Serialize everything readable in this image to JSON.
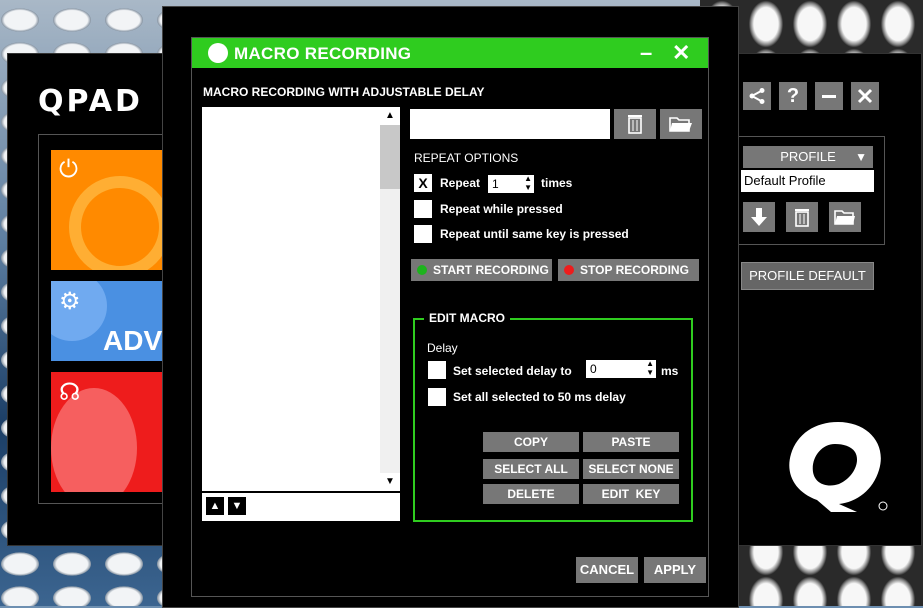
{
  "app": {
    "logo": "QPAD",
    "tile_advanced_label": "ADV",
    "top_icons": [
      "share-icon",
      "help-icon",
      "minimize-icon",
      "close-icon"
    ],
    "help_glyph": "?",
    "profile": {
      "header": "PROFILE",
      "header_arrow": "▼",
      "selected": "Default Profile",
      "buttons": [
        "download-icon",
        "trash-icon",
        "folder-icon"
      ]
    },
    "profile_default_button": "PROFILE DEFAULT"
  },
  "dialog": {
    "title": "MACRO RECORDING",
    "minimize_glyph": "–",
    "close_glyph": "✕",
    "subtitle": "MACRO RECORDING WITH ADJUSTABLE DELAY",
    "name_input_value": "",
    "list_scroll_up": "▲",
    "list_scroll_down": "▼",
    "move_up": "▲",
    "move_down": "▼",
    "repeat_options_label": "REPEAT OPTIONS",
    "repeat": {
      "checked_glyph": "X",
      "label": "Repeat",
      "value": "1",
      "suffix": "times"
    },
    "repeat_while_pressed": "Repeat while pressed",
    "repeat_until_same_key": "Repeat until same key is pressed",
    "start_recording": "START RECORDING",
    "stop_recording": "STOP RECORDING",
    "colors": {
      "accent": "#2fcc1f",
      "start_led": "#1db31d",
      "stop_led": "#ee1c1c",
      "button_gray": "#777777"
    },
    "edit_macro": {
      "legend": "EDIT MACRO",
      "delay_label": "Delay",
      "set_selected_delay": "Set selected delay to",
      "delay_value": "0",
      "delay_unit": "ms",
      "set_all_selected": "Set all selected to 50 ms delay",
      "copy": "COPY",
      "paste": "PASTE",
      "select_all": "SELECT ALL",
      "select_none": "SELECT NONE",
      "delete": "DELETE",
      "edit_key": "EDIT  KEY"
    },
    "cancel": "CANCEL",
    "apply": "APPLY"
  }
}
